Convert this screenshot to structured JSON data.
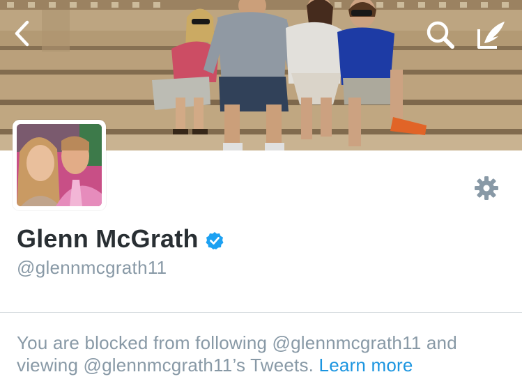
{
  "header": {
    "back_icon": "chevron-left-icon",
    "search_icon": "search-icon",
    "compose_icon": "compose-tweet-icon"
  },
  "profile": {
    "display_name": "Glenn McGrath",
    "screen_name": "@glennmcgrath11",
    "verified_icon": "verified-badge-icon",
    "settings_icon": "gear-icon"
  },
  "blocked_notice": {
    "message": "You are blocked from following @glennmcgrath11 and viewing @glennmcgrath11’s Tweets.",
    "learn_more_label": "Learn more"
  },
  "colors": {
    "name_text": "#292f33",
    "secondary_text": "#8899a6",
    "link": "#1b95e0",
    "verified": "#1da1f2",
    "divider": "#d9dee2"
  }
}
